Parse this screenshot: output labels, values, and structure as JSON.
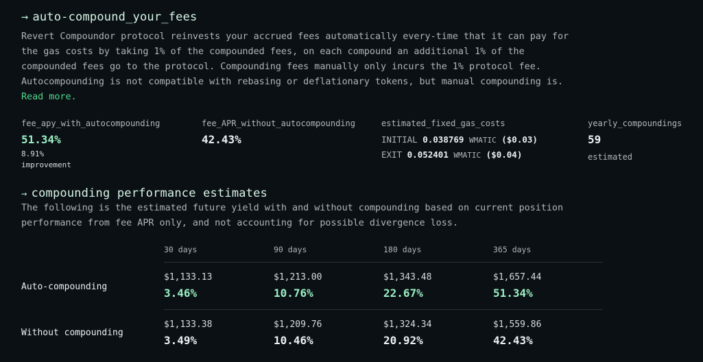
{
  "section1": {
    "title": "auto-compound_your_fees",
    "paragraph": [
      "Revert Compoundor protocol reinvests your accrued fees automatically every-time that it can pay for",
      "the gas costs by taking 1% of the compounded fees, on each compound an additional 1% of the",
      "compounded fees go to the protocol. Compounding fees manually only incurs the 1% protocol fee.",
      "Autocompounding is not compatible with rebasing or deflationary tokens, but manual compounding is."
    ],
    "read_more": "Read more."
  },
  "stats": {
    "apy_label": "fee_apy_with_autocompounding",
    "apy_value": "51.34%",
    "apy_improvement_value": "8.91%",
    "apy_improvement_label": "improvement",
    "apr_label": "fee_APR_without_autocompounding",
    "apr_value": "42.43%",
    "gas_label": "estimated_fixed_gas_costs",
    "gas_initial_label": "INITIAL",
    "gas_initial_value": "0.038769",
    "gas_initial_token": "WMATIC",
    "gas_initial_usd": "($0.03)",
    "gas_exit_label": "EXIT",
    "gas_exit_value": "0.052401",
    "gas_exit_token": "WMATIC",
    "gas_exit_usd": "($0.04)",
    "yearly_label": "yearly_compoundings",
    "yearly_value": "59",
    "yearly_note": "estimated"
  },
  "section2": {
    "title": "compounding performance estimates",
    "paragraph": [
      "The following is the estimated future yield with and without compounding based on current position",
      "performance from fee APR only, and not accounting for possible divergence loss."
    ]
  },
  "table": {
    "columns": [
      "30 days",
      "90 days",
      "180 days",
      "365 days"
    ],
    "rows": [
      {
        "label": "Auto-compounding",
        "amounts": [
          "$1,133.13",
          "$1,213.00",
          "$1,343.48",
          "$1,657.44"
        ],
        "percents": [
          "3.46%",
          "10.76%",
          "22.67%",
          "51.34%"
        ]
      },
      {
        "label": "Without compounding",
        "amounts": [
          "$1,133.38",
          "$1,209.76",
          "$1,324.34",
          "$1,559.86"
        ],
        "percents": [
          "3.49%",
          "10.46%",
          "20.92%",
          "42.43%"
        ]
      }
    ]
  }
}
